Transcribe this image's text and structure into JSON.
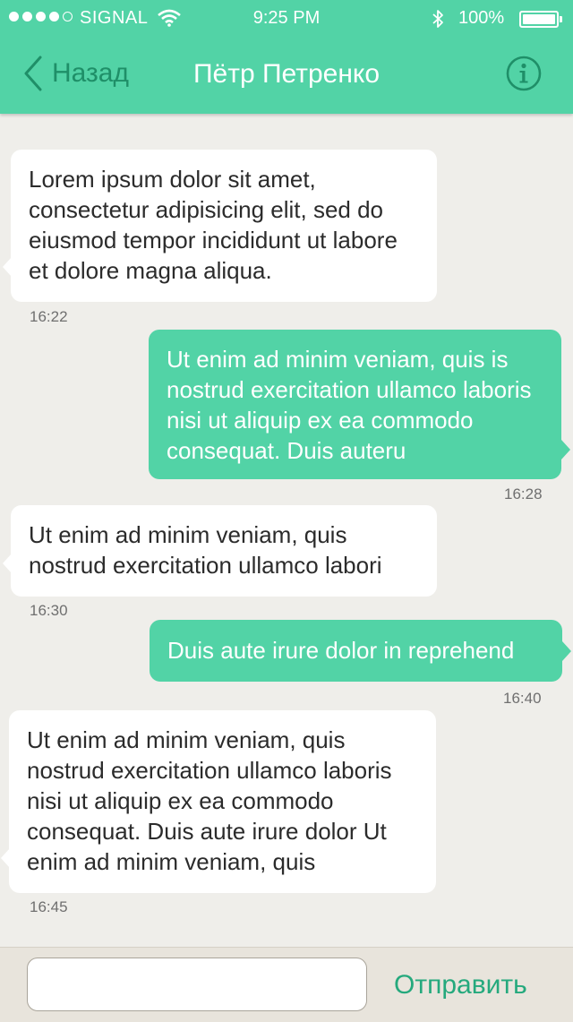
{
  "status_bar": {
    "carrier": "SIGNAL",
    "time": "9:25 PM",
    "battery": "100%",
    "signal_bars_filled": 4,
    "signal_bars_total": 5
  },
  "nav": {
    "back_label": "Назад",
    "title": "Пётр Петренко",
    "info_icon": "info-icon"
  },
  "messages": [
    {
      "direction": "in",
      "text": "Lorem ipsum dolor sit amet, consectetur adipisicing elit, sed do eiusmod tempor incididunt ut labore et dolore magna aliqua.",
      "time": "16:22"
    },
    {
      "direction": "out",
      "text": "Ut enim ad minim veniam, quis is nostrud exercitation ullamco laboris nisi ut aliquip ex ea commodo consequat. Duis auteru",
      "time": "16:28"
    },
    {
      "direction": "in",
      "text": "Ut enim ad minim veniam, quis nostrud exercitation ullamco labori",
      "time": "16:30"
    },
    {
      "direction": "out",
      "text": "Duis aute irure dolor in reprehend",
      "time": "16:40"
    },
    {
      "direction": "in",
      "text": "Ut enim ad minim veniam, quis nostrud exercitation ullamco laboris nisi ut aliquip ex ea commodo consequat. Duis aute irure dolor Ut enim ad minim veniam, quis",
      "time": "16:45"
    }
  ],
  "composer": {
    "value": "",
    "placeholder": "",
    "send_label": "Отправить"
  },
  "colors": {
    "accent": "#52d3a6",
    "accent_dark": "#1f8f68",
    "send_text": "#25a97d",
    "background": "#efeeea"
  }
}
